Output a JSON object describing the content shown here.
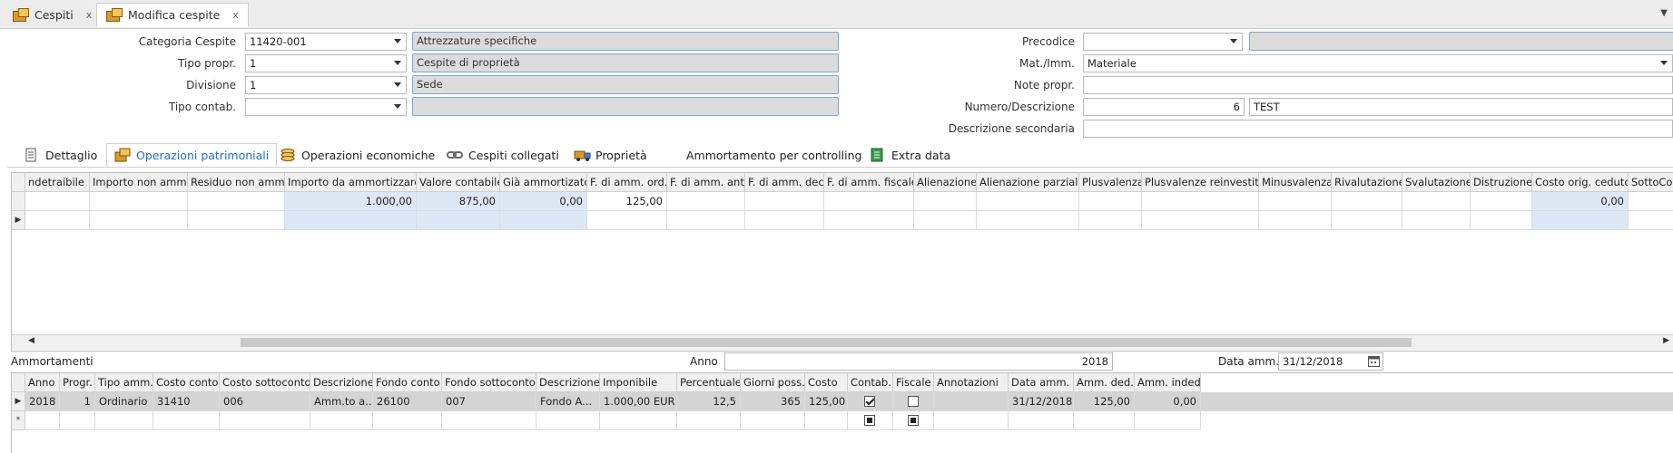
{
  "tabs": [
    {
      "label": "Cespiti",
      "close": "x"
    },
    {
      "label": "Modifica cespite",
      "close": "x"
    }
  ],
  "form": {
    "categoria_label": "Categoria Cespite",
    "categoria_value": "11420-001",
    "categoria_desc": "Attrezzature specifiche",
    "tipo_propr_label": "Tipo propr.",
    "tipo_propr_value": "1",
    "tipo_propr_desc": "Cespite di proprietà",
    "divisione_label": "Divisione",
    "divisione_value": "1",
    "divisione_desc": "Sede",
    "tipo_contab_label": "Tipo contab.",
    "tipo_contab_value": "",
    "tipo_contab_desc": "",
    "precodice_label": "Precodice",
    "precodice_value": "",
    "mat_imm_label": "Mat./Imm.",
    "mat_imm_value": "Materiale",
    "note_label": "Note propr.",
    "note_value": "",
    "numero_label": "Numero/Descrizione",
    "numero_value": "6",
    "descrizione_value": "TEST",
    "desc_sec_label": "Descrizione secondaria",
    "desc_sec_value": ""
  },
  "section_tabs": [
    {
      "label": "Dettaglio",
      "icon": "document-icon"
    },
    {
      "label": "Operazioni patrimoniali",
      "icon": "coins-icon"
    },
    {
      "label": "Operazioni economiche",
      "icon": "stack-coins-icon"
    },
    {
      "label": "Cespiti collegati",
      "icon": "chain-link-icon"
    },
    {
      "label": "Proprietà",
      "icon": "truck-icon"
    },
    {
      "label": "Ammortamento per controlling",
      "icon": ""
    },
    {
      "label": "Extra data",
      "icon": "green-sheet-icon"
    }
  ],
  "ops_grid": {
    "columns": [
      "ndetraibile",
      "Importo non amm.",
      "Residuo non amm.",
      "Importo da ammortizzare",
      "Valore contabile",
      "Già ammortizato",
      "F. di amm. ord.",
      "F. di amm. ant.",
      "F. di amm. dec.",
      "F. di amm. fiscale",
      "Alienazione",
      "Alienazione parziale",
      "Plusvalenza",
      "Plusvalenze reinvestita",
      "Minusvalenza",
      "Rivalutazione",
      "Svalutazione",
      "Distruzione",
      "Costo orig. ceduto",
      "SottoConto"
    ],
    "row": [
      "",
      "",
      "",
      "1.000,00",
      "875,00",
      "0,00",
      "125,00",
      "",
      "",
      "",
      "",
      "",
      "",
      "",
      "",
      "",
      "",
      "",
      "0,00",
      ""
    ]
  },
  "ammortamenti": {
    "title": "Ammortamenti",
    "anno_label": "Anno",
    "anno_value": "2018",
    "data_label": "Data amm.",
    "data_value": "31/12/2018",
    "columns": [
      "Anno",
      "Progr.",
      "Tipo amm.",
      "Costo conto",
      "Costo sottoconto",
      "Descrizione",
      "Fondo conto",
      "Fondo sottoconto",
      "Descrizione",
      "Imponibile",
      "Percentuale",
      "Giorni poss.",
      "Costo",
      "Contab.",
      "Fiscale",
      "Annotazioni",
      "Data amm.",
      "Amm. ded.",
      "Amm. inded."
    ],
    "row": [
      "2018",
      "1",
      "Ordinario",
      "31410",
      "006",
      "Amm.to a...",
      "26100",
      "007",
      "Fondo A...",
      "1.000,00 EUR",
      "12,5",
      "365",
      "125,00",
      "",
      "",
      "",
      "31/12/2018",
      "125,00",
      "0,00"
    ],
    "new_row_marker": "*"
  }
}
